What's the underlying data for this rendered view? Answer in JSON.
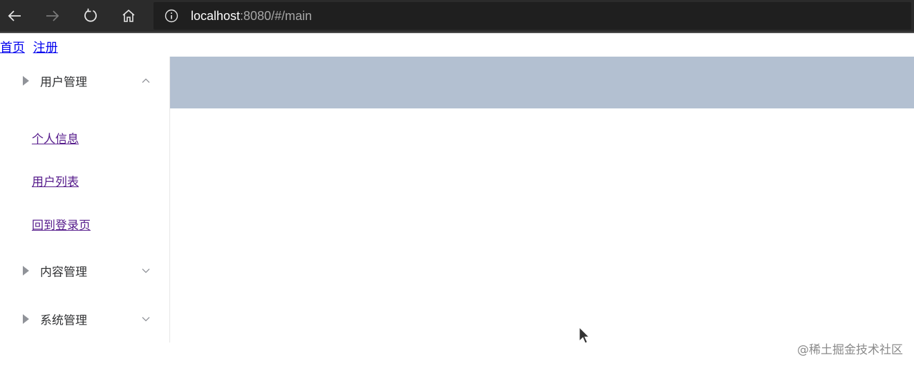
{
  "browser": {
    "url_host": "localhost",
    "url_path": ":8080/#/main",
    "back_icon": "back-arrow-icon",
    "forward_icon": "forward-arrow-icon",
    "refresh_icon": "refresh-icon",
    "home_icon": "home-icon",
    "info_icon": "info-icon"
  },
  "top_links": {
    "home": "首页",
    "register": "注册"
  },
  "sidebar": {
    "menus": [
      {
        "label": "用户管理",
        "expanded": true,
        "items": [
          "个人信息",
          "用户列表",
          "回到登录页"
        ]
      },
      {
        "label": "内容管理",
        "expanded": false
      },
      {
        "label": "系统管理",
        "expanded": false
      }
    ]
  },
  "colors": {
    "header_band": "#b3c0d1",
    "browser_bar": "#2b2b2b",
    "visited_link": "#551a8b",
    "link": "#0000ee"
  },
  "watermark": "@稀土掘金技术社区"
}
